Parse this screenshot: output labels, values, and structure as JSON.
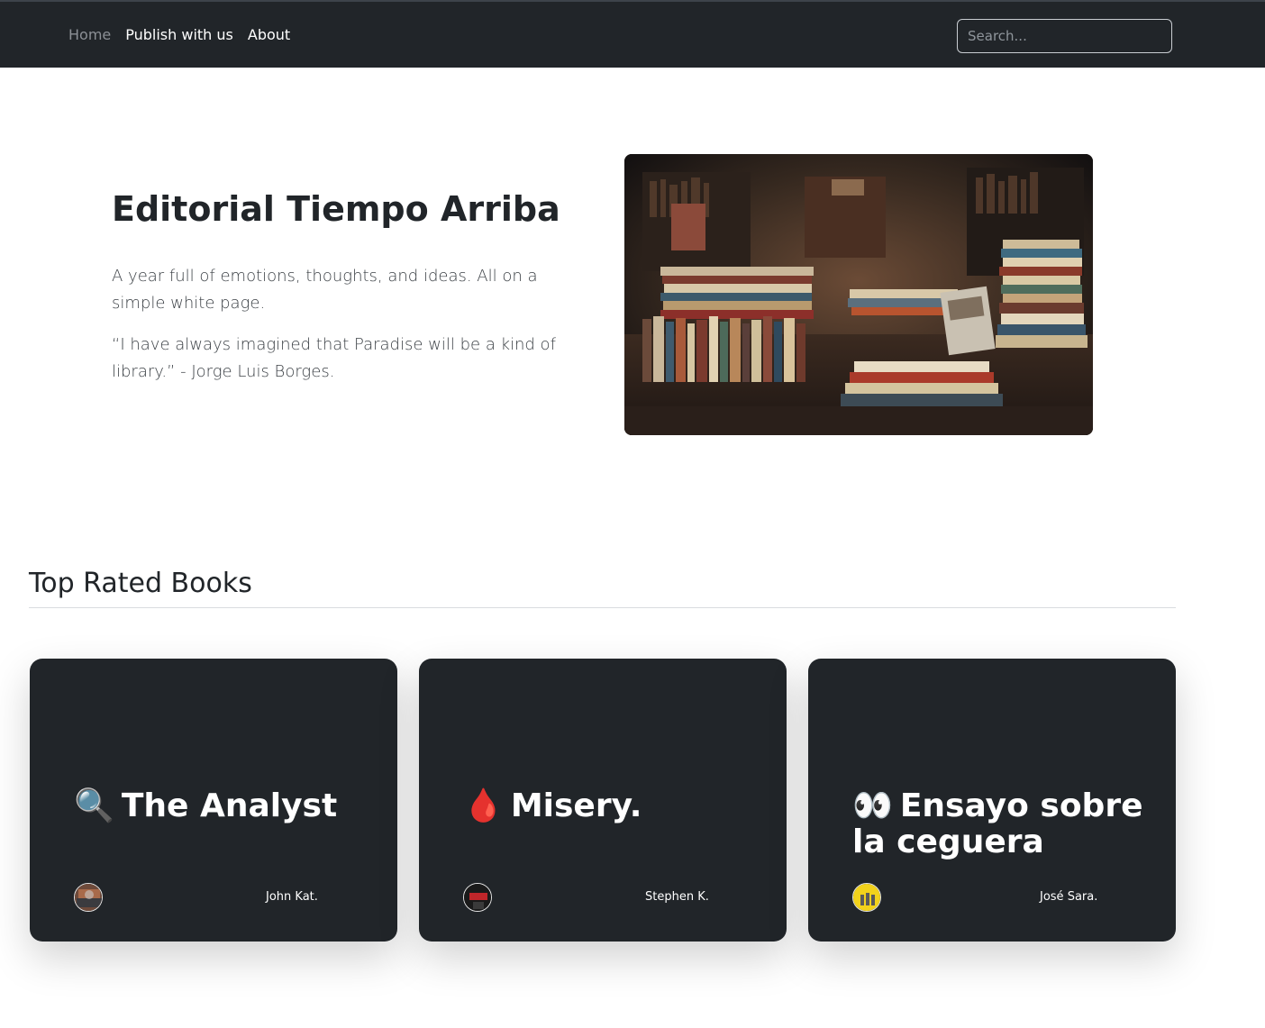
{
  "nav": {
    "links": [
      {
        "label": "Home"
      },
      {
        "label": "Publish with us"
      },
      {
        "label": "About"
      }
    ],
    "search_placeholder": "Search..."
  },
  "hero": {
    "title": "Editorial Tiempo Arriba",
    "paragraph1": "A year full of emotions, thoughts, and ideas. All on a simple white page.",
    "paragraph2": "“I have always imagined that Paradise will be a kind of library.” - Jorge Luis Borges."
  },
  "top_rated": {
    "heading": "Top Rated Books",
    "cards": [
      {
        "emoji": "🔍",
        "title": "The Analyst",
        "author": "John Kat."
      },
      {
        "emoji": "🩸",
        "title": "Misery.",
        "author": "Stephen K."
      },
      {
        "emoji": "👀",
        "title": "Ensayo sobre la ceguera",
        "author": "José Sara."
      }
    ]
  },
  "colors": {
    "navbar_bg": "#212529",
    "card_bg": "#212529",
    "text_dark": "#212529"
  }
}
